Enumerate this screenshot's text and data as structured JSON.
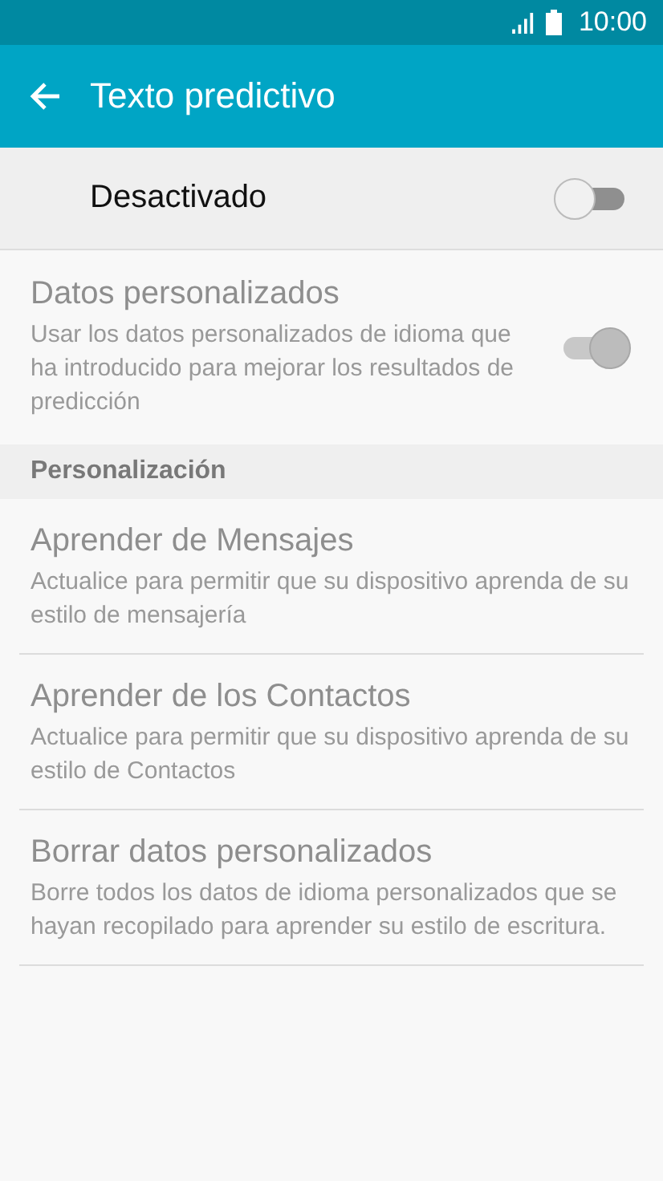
{
  "status_bar": {
    "time": "10:00"
  },
  "app_bar": {
    "title": "Texto predictivo"
  },
  "master_switch": {
    "label": "Desactivado",
    "on": false
  },
  "personal_data": {
    "title": "Datos personalizados",
    "summary": "Usar los datos personalizados de idioma que ha introducido para mejorar los resultados de predicción",
    "on": true,
    "disabled": true
  },
  "section": {
    "title": "Personalización"
  },
  "items": [
    {
      "title": "Aprender de Mensajes",
      "summary": "Actualice para permitir que su dispositivo aprenda de su estilo de mensajería",
      "disabled": true
    },
    {
      "title": "Aprender de los Contactos",
      "summary": "Actualice para permitir que su dispositivo aprenda de su estilo de Contactos",
      "disabled": true
    },
    {
      "title": "Borrar datos personalizados",
      "summary": "Borre todos los datos de idioma personalizados que se hayan recopilado para aprender su estilo de escritura.",
      "disabled": true
    }
  ]
}
